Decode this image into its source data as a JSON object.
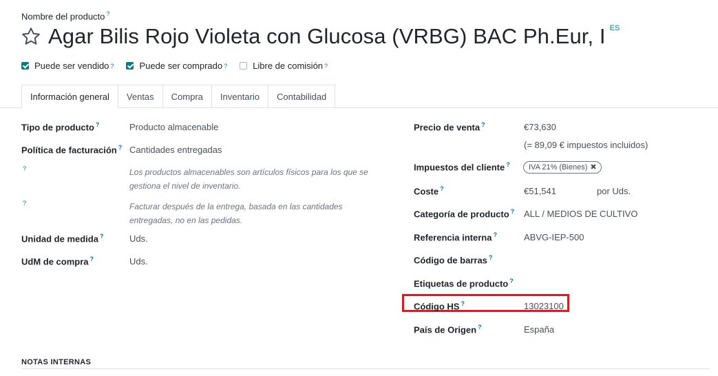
{
  "header": {
    "product_label": "Nombre del producto",
    "product_name": "Agar Bilis Rojo Violeta con Glucosa (VRBG) BAC Ph.Eur, I",
    "language": "ES",
    "help": "?"
  },
  "checkboxes": [
    {
      "label": "Puede ser vendido",
      "checked": true
    },
    {
      "label": "Puede ser comprado",
      "checked": true
    },
    {
      "label": "Libre de comisión",
      "checked": false
    }
  ],
  "tabs": [
    {
      "label": "Información general",
      "active": true
    },
    {
      "label": "Ventas",
      "active": false
    },
    {
      "label": "Compra",
      "active": false
    },
    {
      "label": "Inventario",
      "active": false
    },
    {
      "label": "Contabilidad",
      "active": false
    }
  ],
  "left": {
    "product_type_label": "Tipo de producto",
    "product_type_value": "Producto almacenable",
    "invoice_policy_label": "Política de facturación",
    "invoice_policy_value": "Cantidades entregadas",
    "help1": "Los productos almacenables son artículos físicos para los que se gestiona el nivel de inventario.",
    "help2": "Facturar después de la entrega, basada en las cantidades entregadas, no en las pedidas.",
    "uom_label": "Unidad de medida",
    "uom_value": "Uds.",
    "purchase_uom_label": "UdM de compra",
    "purchase_uom_value": "Uds."
  },
  "right": {
    "sale_price_label": "Precio de venta",
    "sale_price_value": "€73,630",
    "sale_price_taxed": "(= 89,09 € impuestos incluidos)",
    "customer_taxes_label": "Impuestos del cliente",
    "customer_tax_tag": "IVA 21% (Bienes)",
    "cost_label": "Coste",
    "cost_value": "€51,541",
    "cost_unit": "por Uds.",
    "category_label": "Categoría de producto",
    "category_value": "ALL / MEDIOS DE CULTIVO",
    "internal_ref_label": "Referencia interna",
    "internal_ref_value": "ABVG-IEP-500",
    "barcode_label": "Código de barras",
    "tags_label": "Etiquetas de producto",
    "hs_code_label": "Código HS",
    "hs_code_value": "13023100",
    "origin_label": "País de Origen",
    "origin_value": "España"
  },
  "notes": {
    "title": "NOTAS INTERNAS"
  },
  "colors": {
    "accent": "#017e84",
    "highlight": "#e0191d"
  }
}
